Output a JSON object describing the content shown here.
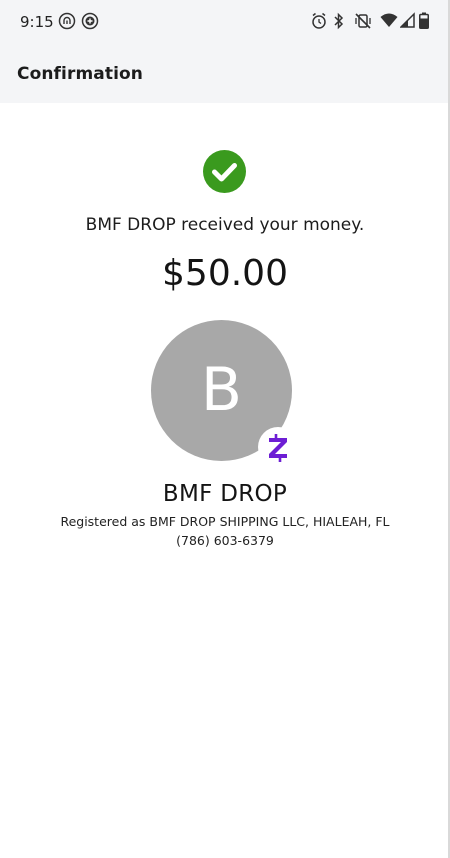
{
  "status_bar": {
    "time": "9:15",
    "left_icons": [
      "fingerprint-icon",
      "add-circle-icon"
    ],
    "right_icons": [
      "alarm-icon",
      "bluetooth-icon",
      "vibrate-off-icon",
      "wifi-icon",
      "signal-icon",
      "battery-icon"
    ]
  },
  "app_bar": {
    "title": "Confirmation"
  },
  "confirmation": {
    "status_icon": "check-circle-icon",
    "status_color": "#3a9a1e",
    "message": "BMF DROP received your money.",
    "amount": "$50.00"
  },
  "recipient": {
    "avatar_initial": "B",
    "avatar_color": "#a8a8a8",
    "badge_icon": "zelle-icon",
    "badge_color": "#6d1ed4",
    "name": "BMF DROP",
    "registered": "Registered as BMF DROP SHIPPING LLC, HIALEAH, FL",
    "phone": "(786) 603-6379"
  }
}
